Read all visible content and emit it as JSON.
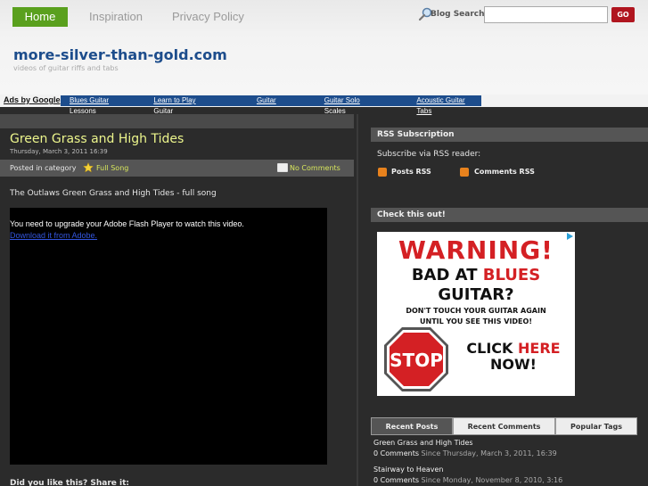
{
  "nav": {
    "items": [
      {
        "label": "Home",
        "active": true
      },
      {
        "label": "Inspiration",
        "active": false
      },
      {
        "label": "Privacy Policy",
        "active": false
      }
    ]
  },
  "search": {
    "label": "Blog Search",
    "value": "",
    "go_label": "GO",
    "icon": "search-icon"
  },
  "site": {
    "title": "more-silver-than-gold.com",
    "tagline": "videos of guitar riffs and tabs"
  },
  "ads": {
    "by_google": "Ads by Google",
    "links": [
      "Blues Guitar Lessons",
      "Learn to Play Guitar",
      "Guitar",
      "Guitar Solo Scales",
      "Acoustic Guitar Tabs"
    ]
  },
  "post": {
    "title": "Green Grass and High Tides",
    "date": "Thursday, March 3, 2011 16:39",
    "posted_in_label": "Posted in category",
    "category": "Full Song",
    "comments_link": "No Comments",
    "intro": "The Outlaws Green Grass and High Tides - full song",
    "flash_message": "You need to upgrade your Adobe Flash Player to watch this video.",
    "flash_link": "Download it from Adobe.",
    "share_prompt": "Did you like this? Share it:"
  },
  "sidebar": {
    "rss": {
      "heading": "RSS Subscription",
      "subscribe_text": "Subscribe via RSS reader:",
      "posts_rss": "Posts RSS",
      "comments_rss": "Comments RSS"
    },
    "check": {
      "heading": "Check this out!"
    },
    "ad_banner": {
      "warning": "WARNING!",
      "line1_prefix": "BAD AT ",
      "line1_highlight": "BLUES",
      "line2": "GUITAR?",
      "small_line1": "DON'T TOUCH YOUR GUITAR AGAIN",
      "small_line2": "UNTIL YOU SEE THIS VIDEO!",
      "stop_text": "STOP",
      "click_prefix": "CLICK ",
      "click_highlight": "HERE",
      "click_suffix": "NOW!"
    },
    "tabs": [
      "Recent Posts",
      "Recent Comments",
      "Popular Tags"
    ],
    "recent_posts": [
      {
        "title": "Green Grass and High Tides",
        "comments": "0 Comments",
        "since": "Since Thursday, March 3, 2011, 16:39"
      },
      {
        "title": "Stairway to Heaven",
        "comments": "0 Comments",
        "since": "Since Monday, November 8, 2010, 3:16"
      }
    ]
  },
  "colors": {
    "nav_active": "#5aa01e",
    "site_title": "#1d4d8c",
    "post_title": "#ecf58c",
    "link_accent": "#d7e65c",
    "go_button": "#b0151f",
    "background": "#2b2b2b"
  }
}
